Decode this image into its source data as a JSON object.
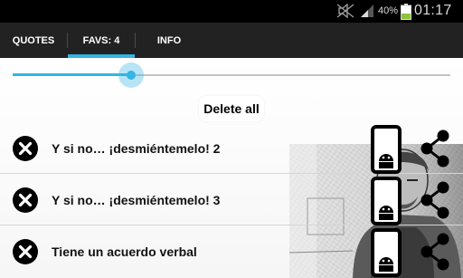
{
  "status_bar": {
    "battery_percent": "40%",
    "battery_level": 0.4,
    "time": "01:17",
    "icons": [
      "mute-icon",
      "signal-icon",
      "battery-icon"
    ]
  },
  "tabs": [
    {
      "label": "QUOTES",
      "selected": false
    },
    {
      "label": "FAVS: 4",
      "selected": true
    },
    {
      "label": "INFO",
      "selected": false
    }
  ],
  "slider": {
    "value": 0.27
  },
  "actions": {
    "delete_all_label": "Delete all"
  },
  "favorites": [
    {
      "text": "Y si no… ¡desmiéntemelo! 2"
    },
    {
      "text": "Y si no… ¡desmiéntemelo! 3"
    },
    {
      "text": "Tiene un acuerdo verbal"
    }
  ],
  "row_icons": {
    "remove": "remove-icon",
    "phone": "phone-icon",
    "share": "share-icon"
  },
  "colors": {
    "accent": "#33b5e5",
    "tab_bar": "#222222",
    "status_bar": "#000000",
    "battery_fill": "#8ec13d"
  }
}
